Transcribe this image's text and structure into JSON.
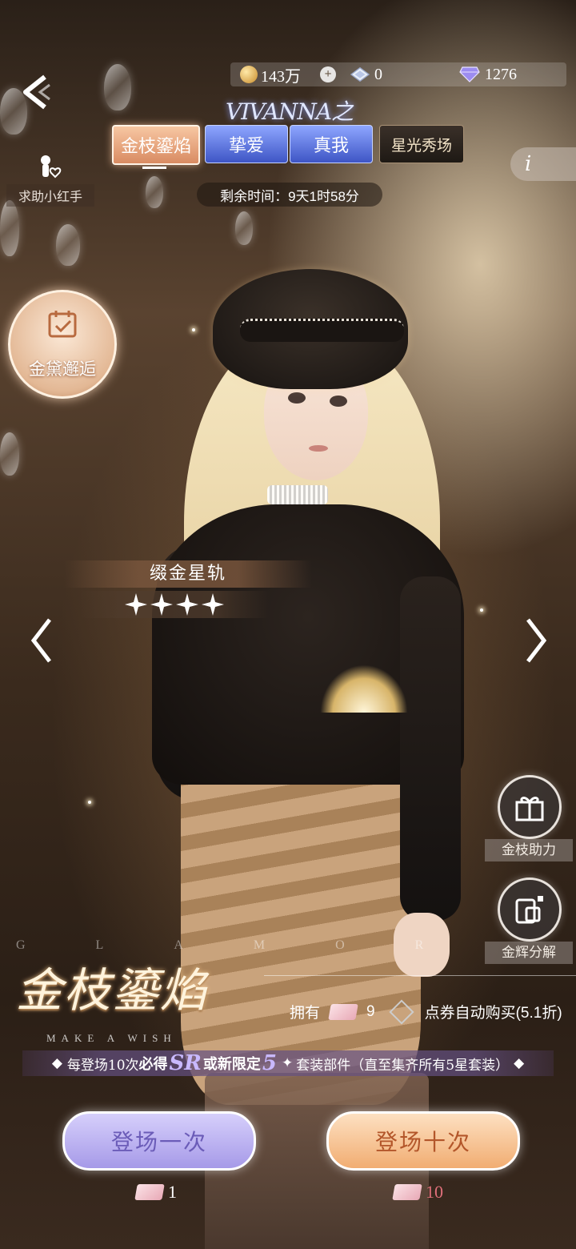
{
  "resources": {
    "coins": "143万",
    "diamonds": "0",
    "gems": "1276"
  },
  "helper": {
    "label": "求助小红手"
  },
  "event": {
    "title": "VIVANNA之夜",
    "tabs": [
      {
        "label": "金枝鎏焰",
        "active": true
      },
      {
        "label": "挚爱",
        "active": false
      },
      {
        "label": "真我",
        "active": false
      },
      {
        "label": "星光秀场",
        "active": false
      }
    ],
    "remaining_time": "剩余时间：9天1时58分",
    "info_label": "i"
  },
  "side_event": {
    "label": "金黛邂逅"
  },
  "item": {
    "name": "缀金星轨",
    "stars": 4
  },
  "right_buttons": {
    "assist_label": "金枝助力",
    "decompose_label": "金辉分解"
  },
  "banner": {
    "glamor": "GLAMOR",
    "logo": "金枝鎏焰",
    "logo_sub": "MAKE A WISH",
    "owned_label": "拥有",
    "owned_count": "9",
    "auto_buy_label": "点券自动购买(5.1折)",
    "promo_pre": "每登场10次",
    "promo_must": "必得",
    "promo_sr": "SR",
    "promo_or": "或新限定",
    "promo_five": "5",
    "promo_post": "套装部件（直至集齐所有5星套装）"
  },
  "actions": {
    "pull_one_label": "登场一次",
    "pull_one_cost": "1",
    "pull_ten_label": "登场十次",
    "pull_ten_cost": "10"
  },
  "colors": {
    "active_tab": "#d98b62",
    "blue_tab": "#3e55c5",
    "pull_one": "#a69ae8",
    "pull_ten": "#f1ad72",
    "cost_ten": "#e0707a"
  }
}
